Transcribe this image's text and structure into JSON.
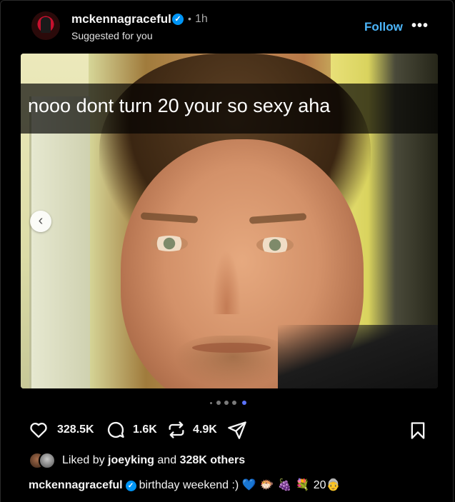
{
  "post": {
    "username": "mckennagraceful",
    "separator": "•",
    "time": "1h",
    "subtitle": "Suggested for you",
    "follow_label": "Follow",
    "more_label": "•••"
  },
  "media": {
    "overlay_text": "nooo dont turn 20 your so sexy aha",
    "prev_label": "‹",
    "carousel": {
      "count": 5,
      "active_index": 4
    }
  },
  "actions": {
    "likes": "328.5K",
    "comments": "1.6K",
    "reposts": "4.9K"
  },
  "liked_by": {
    "prefix": "Liked by",
    "user": "joeyking",
    "middle": "and",
    "others": "328K others"
  },
  "caption": {
    "username": "mckennagraceful",
    "text": "birthday weekend :)",
    "emojis": "💙 🐡 🍇 💐 ",
    "trailing": "20",
    "trailing_emoji": "👵"
  },
  "colors": {
    "accent": "#0095f6",
    "follow": "#4cb5f9",
    "active_dot": "#5b73ff"
  },
  "icons": {
    "like": "heart-icon",
    "comment": "comment-icon",
    "repost": "repost-icon",
    "share": "send-icon",
    "save": "bookmark-icon",
    "verified": "verified-badge-icon"
  }
}
